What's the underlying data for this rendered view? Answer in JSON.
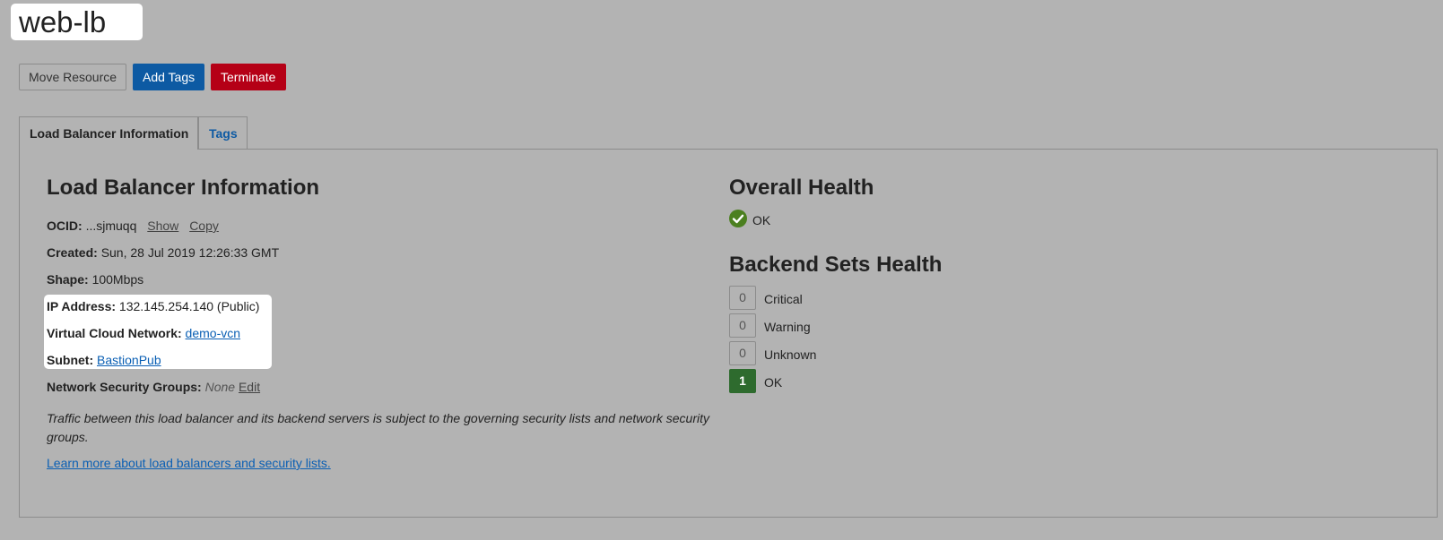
{
  "header": {
    "title": "web-lb"
  },
  "actions": {
    "move_resource": "Move Resource",
    "add_tags": "Add Tags",
    "terminate": "Terminate"
  },
  "tabs": [
    {
      "label": "Load Balancer Information",
      "active": true
    },
    {
      "label": "Tags",
      "active": false
    }
  ],
  "info": {
    "heading": "Load Balancer Information",
    "ocid_label": "OCID:",
    "ocid_value": "...sjmuqq",
    "ocid_show": "Show",
    "ocid_copy": "Copy",
    "created_label": "Created:",
    "created_value": "Sun, 28 Jul 2019 12:26:33 GMT",
    "shape_label": "Shape:",
    "shape_value": "100Mbps",
    "ip_label": "IP Address:",
    "ip_value": "132.145.254.140 (Public)",
    "vcn_label": "Virtual Cloud Network:",
    "vcn_value": "demo-vcn",
    "subnet_label": "Subnet:",
    "subnet_value": "BastionPub",
    "nsg_label": "Network Security Groups:",
    "nsg_value": "None",
    "nsg_edit": "Edit",
    "note": "Traffic between this load balancer and its backend servers is subject to the governing security lists and network security groups.",
    "learn_more": "Learn more about load balancers and security lists."
  },
  "health": {
    "overall_heading": "Overall Health",
    "overall_status": "OK",
    "overall_icon": "check-circle-icon",
    "backend_heading": "Backend Sets Health",
    "backend": [
      {
        "count": "0",
        "label": "Critical"
      },
      {
        "count": "0",
        "label": "Warning"
      },
      {
        "count": "0",
        "label": "Unknown"
      },
      {
        "count": "1",
        "label": "OK"
      }
    ]
  },
  "colors": {
    "background": "#b3b3b3",
    "primary": "#0d5aa3",
    "danger": "#b50016",
    "ok_green": "#2e6b2e",
    "link": "#0a5fb4"
  }
}
